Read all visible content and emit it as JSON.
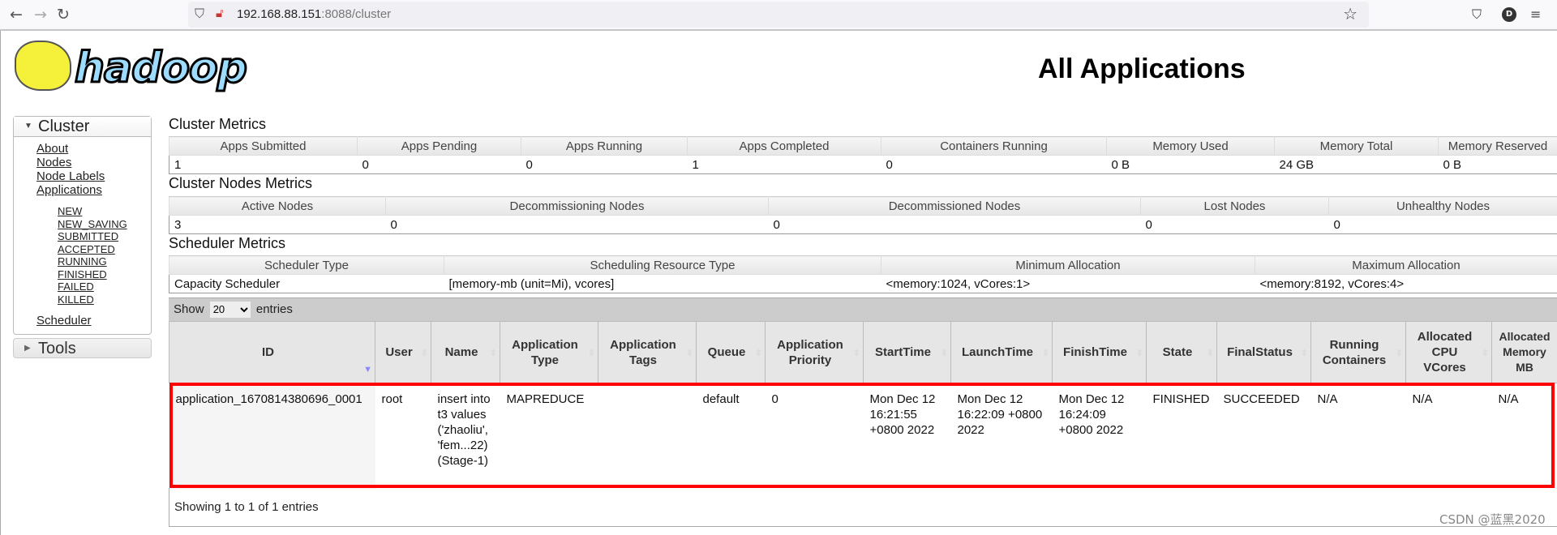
{
  "browser": {
    "url_host": "192.168.88.151",
    "url_rest": ":8088/cluster",
    "avatar_letter": "D"
  },
  "logo_text": "hadoop",
  "page_title": "All Applications",
  "sidebar": {
    "cluster_label": "Cluster",
    "links": [
      "About",
      "Nodes",
      "Node Labels",
      "Applications"
    ],
    "states": [
      "NEW",
      "NEW_SAVING",
      "SUBMITTED",
      "ACCEPTED",
      "RUNNING",
      "FINISHED",
      "FAILED",
      "KILLED"
    ],
    "scheduler": "Scheduler",
    "tools_label": "Tools"
  },
  "cluster_metrics": {
    "title": "Cluster Metrics",
    "headers": [
      "Apps Submitted",
      "Apps Pending",
      "Apps Running",
      "Apps Completed",
      "Containers Running",
      "Memory Used",
      "Memory Total",
      "Memory Reserved"
    ],
    "values": [
      "1",
      "0",
      "0",
      "1",
      "0",
      "0 B",
      "24 GB",
      "0 B"
    ]
  },
  "node_metrics": {
    "title": "Cluster Nodes Metrics",
    "headers": [
      "Active Nodes",
      "Decommissioning Nodes",
      "Decommissioned Nodes",
      "Lost Nodes",
      "Unhealthy Nodes"
    ],
    "values": [
      "3",
      "0",
      "0",
      "0",
      "0"
    ]
  },
  "scheduler_metrics": {
    "title": "Scheduler Metrics",
    "headers": [
      "Scheduler Type",
      "Scheduling Resource Type",
      "Minimum Allocation",
      "Maximum Allocation"
    ],
    "values": [
      "Capacity Scheduler",
      "[memory-mb (unit=Mi), vcores]",
      "<memory:1024, vCores:1>",
      "<memory:8192, vCores:4>"
    ]
  },
  "apps_table": {
    "show_label": "Show",
    "page_size": "20",
    "entries_label": "entries",
    "headers": [
      "ID",
      "User",
      "Name",
      "Application Type",
      "Application Tags",
      "Queue",
      "Application Priority",
      "StartTime",
      "LaunchTime",
      "FinishTime",
      "State",
      "FinalStatus",
      "Running Containers",
      "Allocated CPU VCores",
      "Allocated Memory MB"
    ],
    "rows": [
      [
        "application_1670814380696_0001",
        "root",
        "insert into t3 values ('zhaoliu', 'fem...22) (Stage-1)",
        "MAPREDUCE",
        "",
        "default",
        "0",
        "Mon Dec 12 16:21:55 +0800 2022",
        "Mon Dec 12 16:22:09 +0800 2022",
        "Mon Dec 12 16:24:09 +0800 2022",
        "FINISHED",
        "SUCCEEDED",
        "N/A",
        "N/A",
        "N/A"
      ]
    ],
    "footer": "Showing 1 to 1 of 1 entries"
  },
  "highlight_color": "#ff0000",
  "watermark": "CSDN @蓝黑2020"
}
